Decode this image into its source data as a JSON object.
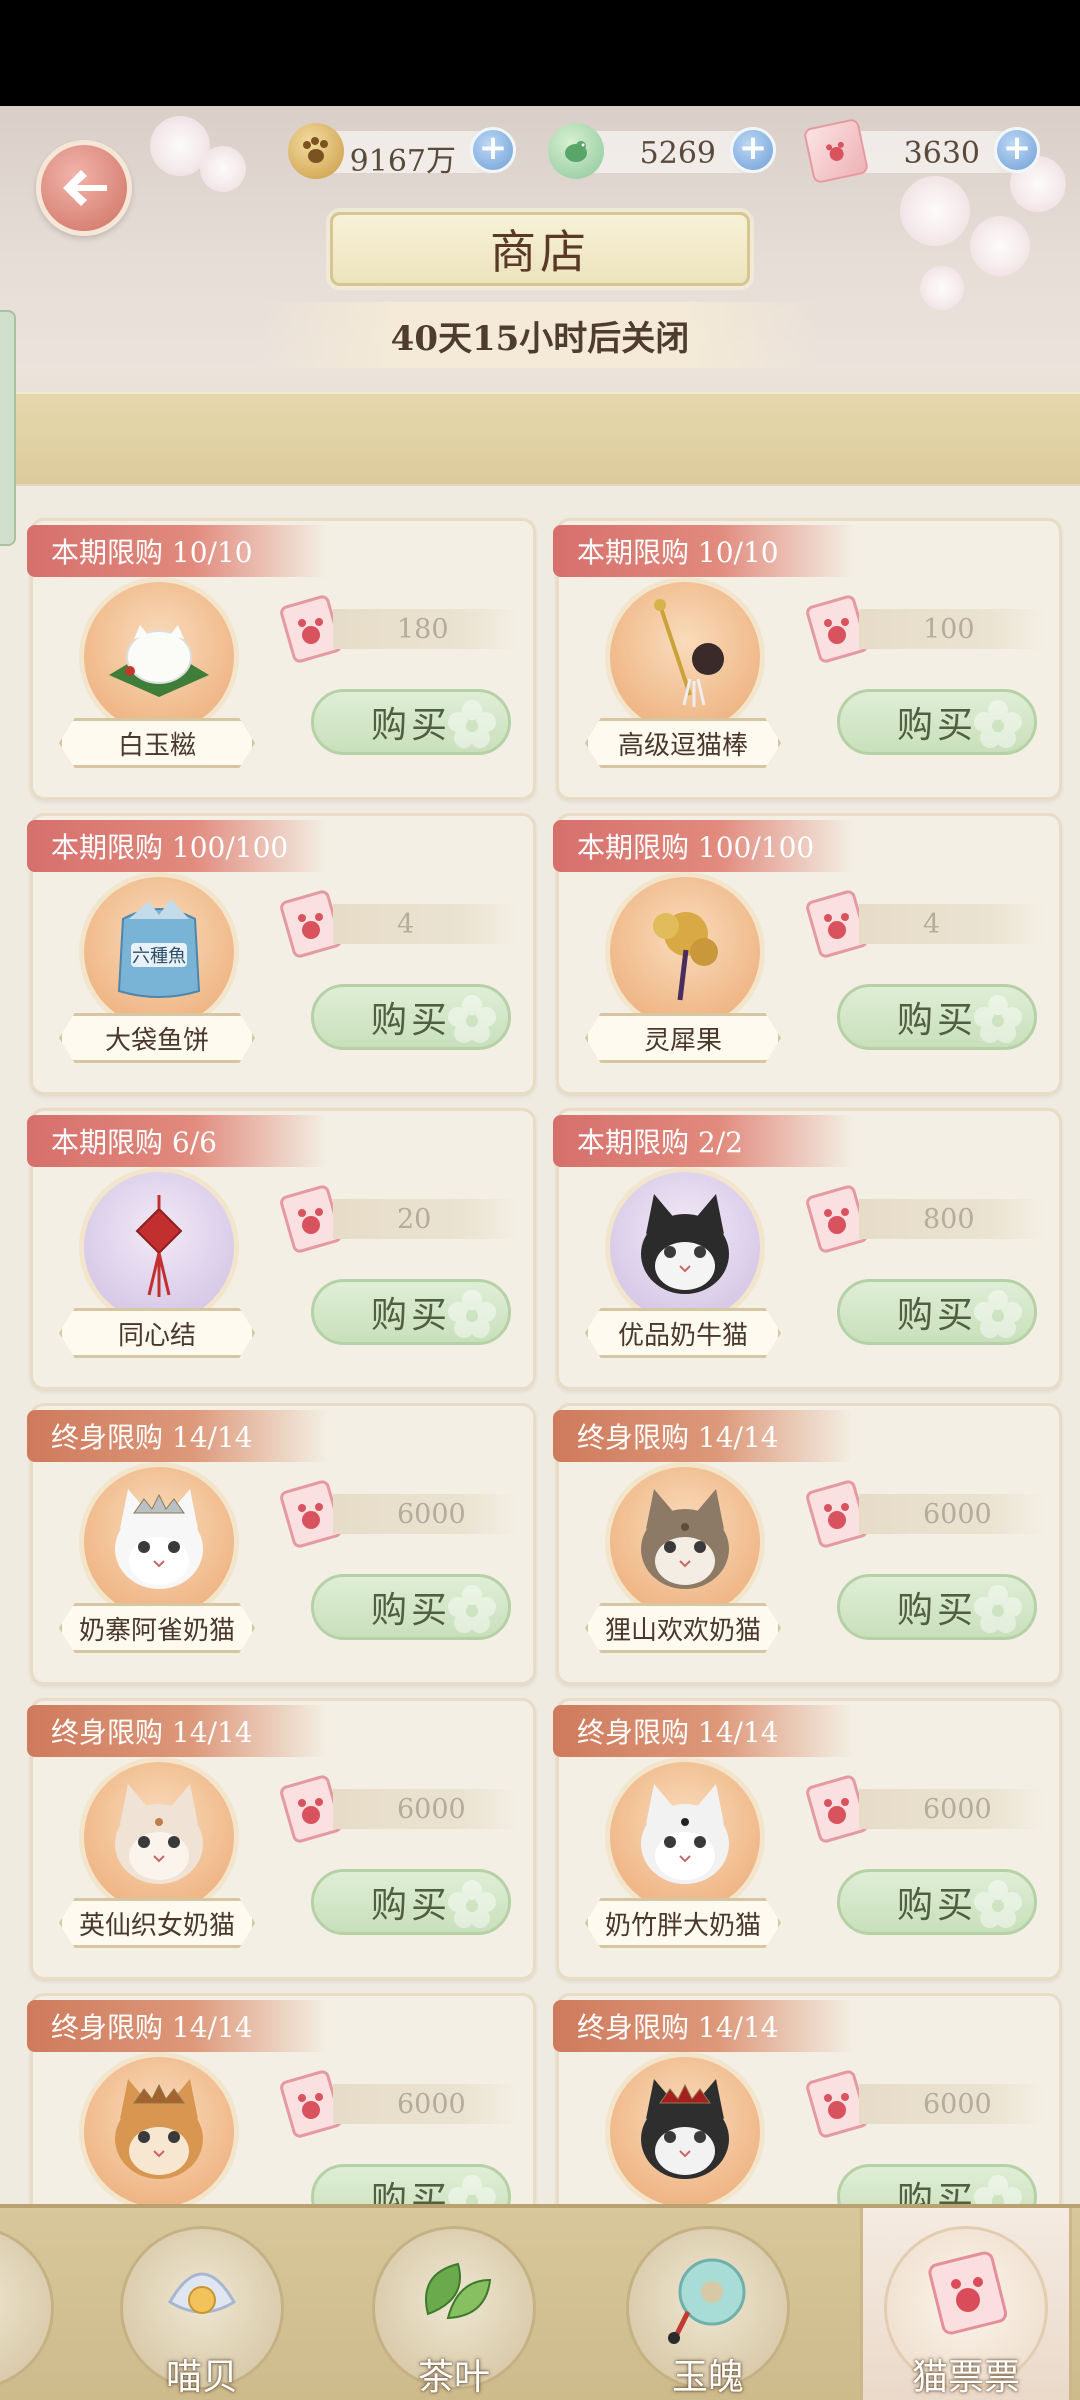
{
  "currencies": [
    {
      "icon": "paw-coin-icon",
      "value": "9167万"
    },
    {
      "icon": "bird-gem-icon",
      "value": "5269"
    },
    {
      "icon": "cat-ticket-icon",
      "value": "3630"
    }
  ],
  "shop": {
    "title": "商店",
    "countdown": "40天15小时后关闭",
    "buy_label": "购买"
  },
  "items": [
    {
      "limit": "本期限购 10/10",
      "kind": "period",
      "name": "白玉糍",
      "price": "180",
      "circle": "orange",
      "art": "rice-cake-icon"
    },
    {
      "limit": "本期限购 10/10",
      "kind": "period",
      "name": "高级逗猫棒",
      "price": "100",
      "circle": "orange",
      "art": "cat-teaser-icon"
    },
    {
      "limit": "本期限购 100/100",
      "kind": "period",
      "name": "大袋鱼饼",
      "price": "4",
      "circle": "orange",
      "art": "fish-cake-bag-icon"
    },
    {
      "limit": "本期限购 100/100",
      "kind": "period",
      "name": "灵犀果",
      "price": "4",
      "circle": "orange",
      "art": "golden-fruit-icon"
    },
    {
      "limit": "本期限购 6/6",
      "kind": "period",
      "name": "同心结",
      "price": "20",
      "circle": "purple",
      "art": "red-knot-icon"
    },
    {
      "limit": "本期限购 2/2",
      "kind": "period",
      "name": "优品奶牛猫",
      "price": "800",
      "circle": "purple",
      "art": "tuxedo-cat-icon"
    },
    {
      "limit": "终身限购 14/14",
      "kind": "life",
      "name": "奶寨阿雀奶猫",
      "price": "6000",
      "circle": "orange",
      "art": "white-cat-crown-icon"
    },
    {
      "limit": "终身限购 14/14",
      "kind": "life",
      "name": "狸山欢欢奶猫",
      "price": "6000",
      "circle": "orange",
      "art": "tabby-cat-icon"
    },
    {
      "limit": "终身限购 14/14",
      "kind": "life",
      "name": "英仙织女奶猫",
      "price": "6000",
      "circle": "orange",
      "art": "orange-cat-icon"
    },
    {
      "limit": "终身限购 14/14",
      "kind": "life",
      "name": "奶竹胖大奶猫",
      "price": "6000",
      "circle": "orange",
      "art": "panda-cat-icon"
    },
    {
      "limit": "终身限购 14/14",
      "kind": "life",
      "name": "",
      "price": "6000",
      "circle": "orange",
      "art": "longhair-cat-icon"
    },
    {
      "limit": "终身限购 14/14",
      "kind": "life",
      "name": "",
      "price": "6000",
      "circle": "orange",
      "art": "black-white-cat-icon"
    }
  ],
  "nav": [
    {
      "label": "喵贝",
      "icon": "shell-pearl-icon"
    },
    {
      "label": "茶叶",
      "icon": "tea-leaf-icon"
    },
    {
      "label": "玉魄",
      "icon": "jade-disc-icon"
    },
    {
      "label": "猫票票",
      "icon": "cat-ticket-icon",
      "active": true
    }
  ]
}
